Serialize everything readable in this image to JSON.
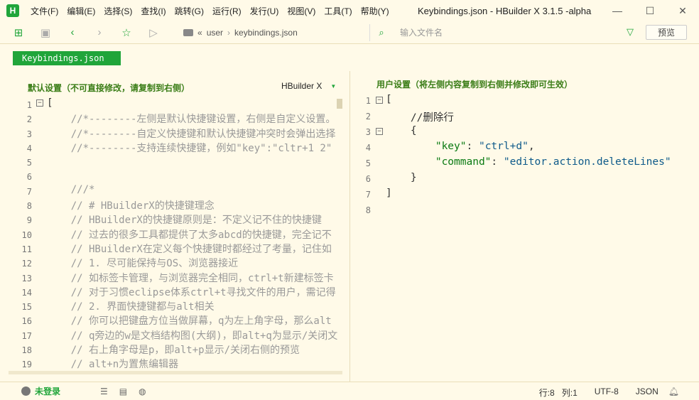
{
  "app": {
    "title": "Keybindings.json - HBuilder X 3.1.5 -alpha",
    "logo_letter": "H",
    "menu": [
      "文件(F)",
      "编辑(E)",
      "选择(S)",
      "查找(I)",
      "跳转(G)",
      "运行(R)",
      "发行(U)",
      "视图(V)",
      "工具(T)",
      "帮助(Y)"
    ]
  },
  "toolbar": {
    "breadcrumb": [
      "user",
      "keybindings.json"
    ],
    "breadcrumb_prefix": "«",
    "breadcrumb_sep": "›",
    "search_placeholder": "输入文件名",
    "preview_label": "预览"
  },
  "tabs": [
    {
      "label": "Keybindings.json"
    }
  ],
  "left_panel": {
    "title": "默认设置（不可直接修改，请复制到右侧）",
    "scheme": "HBuilder X",
    "lines": [
      {
        "n": "1",
        "fold": "⊟",
        "text": "["
      },
      {
        "n": "2",
        "fold": "",
        "text": "    //*--------左侧是默认快捷键设置，右侧是自定义设置。"
      },
      {
        "n": "3",
        "fold": "",
        "text": "    //*--------自定义快捷键和默认快捷键冲突时会弹出选择"
      },
      {
        "n": "4",
        "fold": "",
        "text": "    //*--------支持连续快捷键，例如\"key\":\"cltr+1 2\""
      },
      {
        "n": "5",
        "fold": "",
        "text": ""
      },
      {
        "n": "6",
        "fold": "",
        "text": ""
      },
      {
        "n": "7",
        "fold": "",
        "text": "    ///*"
      },
      {
        "n": "8",
        "fold": "",
        "text": "    // # HBuilderX的快捷键理念"
      },
      {
        "n": "9",
        "fold": "",
        "text": "    // HBuilderX的快捷键原则是：不定义记不住的快捷键"
      },
      {
        "n": "10",
        "fold": "",
        "text": "    // 过去的很多工具都提供了太多abcd的快捷键，完全记不"
      },
      {
        "n": "11",
        "fold": "",
        "text": "    // HBuilderX在定义每个快捷键时都经过了考量，记住如"
      },
      {
        "n": "12",
        "fold": "",
        "text": "    // 1. 尽可能保持与OS、浏览器接近"
      },
      {
        "n": "13",
        "fold": "",
        "text": "    // 如标签卡管理，与浏览器完全相同，ctrl+t新建标签卡"
      },
      {
        "n": "14",
        "fold": "",
        "text": "    // 对于习惯eclipse体系ctrl+t寻找文件的用户，需记得"
      },
      {
        "n": "15",
        "fold": "",
        "text": "    // 2. 界面快捷键都与alt相关"
      },
      {
        "n": "16",
        "fold": "",
        "text": "    // 你可以把键盘方位当做屏幕，q为左上角字母，那么alt"
      },
      {
        "n": "17",
        "fold": "",
        "text": "    // q旁边的w是文档结构图(大纲)，即alt+q为显示/关闭文"
      },
      {
        "n": "18",
        "fold": "",
        "text": "    // 右上角字母是p，即alt+p显示/关闭右侧的预览"
      },
      {
        "n": "19",
        "fold": "",
        "text": "    // alt+n为置焦编辑器"
      }
    ]
  },
  "right_panel": {
    "title": "用户设置（将左侧内容复制到右侧并修改即可生效）",
    "lines": [
      {
        "n": "1",
        "fold": "⊟",
        "html_kind": "bracket",
        "text": "["
      },
      {
        "n": "2",
        "fold": "",
        "html_kind": "comment",
        "text": "    //删除行"
      },
      {
        "n": "3",
        "fold": "⊟",
        "html_kind": "brace",
        "text": "    {"
      },
      {
        "n": "4",
        "fold": "",
        "html_kind": "kv",
        "key": "\"key\"",
        "value": "\"ctrl+d\"",
        "trail": ","
      },
      {
        "n": "5",
        "fold": "",
        "html_kind": "kv",
        "key": "\"command\"",
        "value": "\"editor.action.deleteLines\"",
        "trail": ""
      },
      {
        "n": "6",
        "fold": "",
        "html_kind": "brace",
        "text": "    }"
      },
      {
        "n": "7",
        "fold": "",
        "html_kind": "bracket",
        "text": "]"
      },
      {
        "n": "8",
        "fold": "",
        "html_kind": "empty",
        "text": ""
      }
    ]
  },
  "statusbar": {
    "login": "未登录",
    "cursor_line": "行:8",
    "cursor_col": "列:1",
    "encoding": "UTF-8",
    "language": "JSON"
  },
  "colors": {
    "accent": "#20a53a",
    "background": "#fffae8"
  }
}
